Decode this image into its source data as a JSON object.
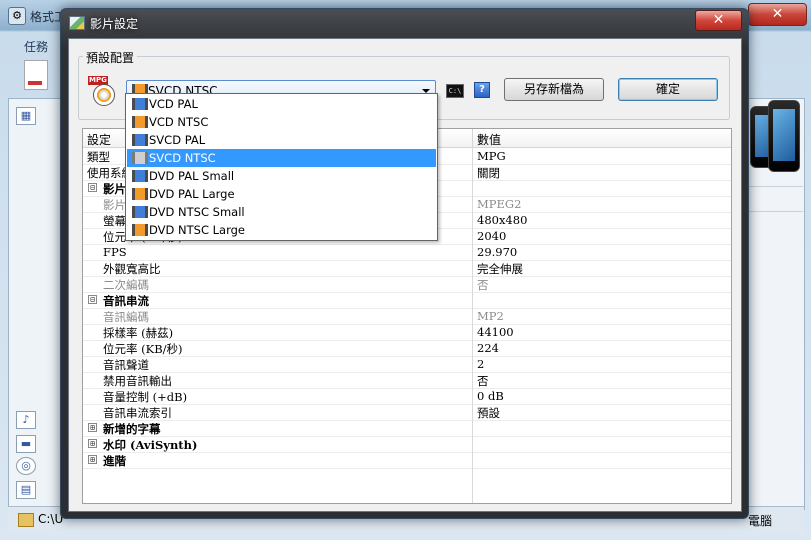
{
  "parent_window": {
    "title": "格式工",
    "close_label": "✕",
    "menu_task": "任務",
    "status_path": "C:\\U",
    "status_right": "電腦"
  },
  "dialog": {
    "title": "影片設定",
    "close_label": "✕",
    "preset_group_label": "預設配置",
    "preset_icon_tag": "MPG",
    "selected_preset": "SVCD NTSC",
    "cmd_icon_text": "C:\\",
    "help_icon_text": "?",
    "save_as_label": "另存新檔為",
    "ok_label": "確定",
    "dropdown_options": [
      {
        "label": "VCD PAL",
        "icon": "blue"
      },
      {
        "label": "VCD NTSC",
        "icon": "orange"
      },
      {
        "label": "SVCD PAL",
        "icon": "blue"
      },
      {
        "label": "SVCD NTSC",
        "icon": "gray",
        "selected": true
      },
      {
        "label": "DVD PAL Small",
        "icon": "blue"
      },
      {
        "label": "DVD PAL Large",
        "icon": "orange"
      },
      {
        "label": "DVD NTSC Small",
        "icon": "blue"
      },
      {
        "label": "DVD NTSC Large",
        "icon": "orange"
      }
    ]
  },
  "grid": {
    "header_setting": "設定",
    "header_value": "數值",
    "rows": [
      {
        "kind": "top",
        "key": "類型",
        "value": "MPG"
      },
      {
        "kind": "top",
        "key": "使用系統",
        "value": "關閉"
      },
      {
        "kind": "sec",
        "key": "影片串流",
        "expander": "⊟",
        "value": ""
      },
      {
        "kind": "dis",
        "key": "影片編碼",
        "value": "MPEG2"
      },
      {
        "kind": "item",
        "key": "螢幕大小",
        "value": "480x480"
      },
      {
        "kind": "item",
        "key": "位元率 (KB/秒)",
        "value": "2040"
      },
      {
        "kind": "item",
        "key": "FPS",
        "value": "29.970"
      },
      {
        "kind": "item",
        "key": "外觀寬高比",
        "value": "完全伸展"
      },
      {
        "kind": "dis",
        "key": "二次編碼",
        "value": "否"
      },
      {
        "kind": "sec",
        "key": "音訊串流",
        "expander": "⊟",
        "value": ""
      },
      {
        "kind": "dis",
        "key": "音訊編碼",
        "value": "MP2"
      },
      {
        "kind": "item",
        "key": "採樣率 (赫茲)",
        "value": "44100"
      },
      {
        "kind": "item",
        "key": "位元率 (KB/秒)",
        "value": "224"
      },
      {
        "kind": "item",
        "key": "音訊聲道",
        "value": "2"
      },
      {
        "kind": "item",
        "key": "禁用音訊輸出",
        "value": "否"
      },
      {
        "kind": "item",
        "key": "音量控制 (+dB)",
        "value": "0 dB"
      },
      {
        "kind": "item",
        "key": "音訊串流索引",
        "value": "預設"
      },
      {
        "kind": "sec",
        "key": "新增的字幕",
        "expander": "⊞",
        "value": ""
      },
      {
        "kind": "sec",
        "key": "水印 (AviSynth)",
        "expander": "⊞",
        "value": ""
      },
      {
        "kind": "sec",
        "key": "進階",
        "expander": "⊞",
        "value": ""
      }
    ]
  }
}
